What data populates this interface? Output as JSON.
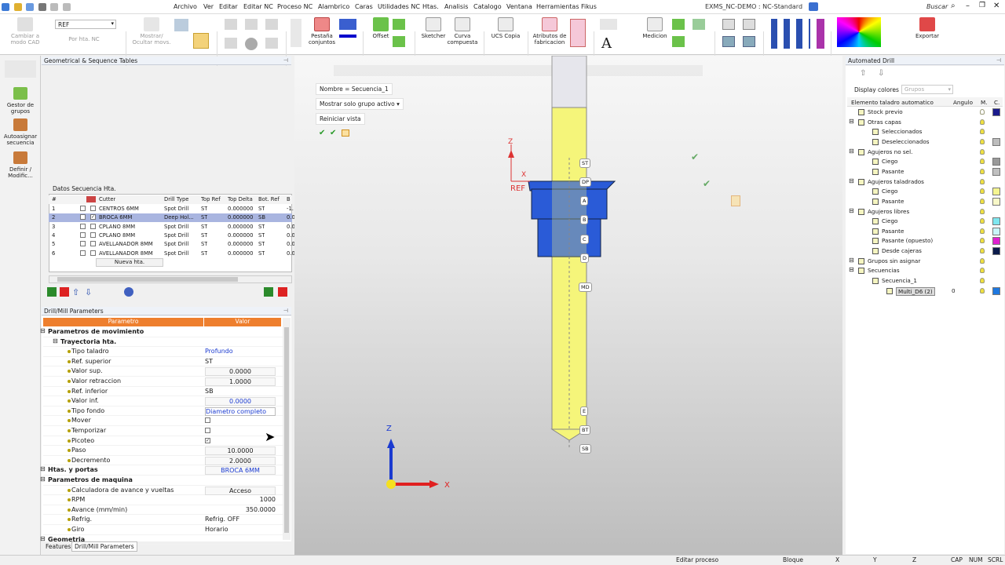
{
  "menubar": {
    "items": [
      "Archivo",
      "Ver",
      "Editar",
      "Editar NC",
      "Proceso NC",
      "Alambrico",
      "Caras",
      "Utilidades NC",
      "Htas.",
      "Analisis",
      "Catalogo",
      "Ventana",
      "Herramientas Fikus"
    ],
    "title": "EXMS_NC-DEMO : NC-Standard",
    "search_label": "Buscar"
  },
  "ribbon": {
    "cambiar_modo": "Cambiar a modo CAD",
    "ref_value": "REF",
    "por_hta": "Por hta. NC",
    "mostrar_ocultar": "Mostrar/ Ocultar movs.",
    "pestana": "Pestaña conjuntos",
    "offset": "Offset",
    "sketcher": "Sketcher",
    "curva": "Curva compuesta",
    "ucs": "UCS Copia",
    "atributos": "Atributos de fabricacion",
    "medicion": "Medicion",
    "exportar": "Exportar"
  },
  "leftbar": {
    "gestor": "Gestor de grupos",
    "autoasignar": "Autoasignar secuencia",
    "definir": "Definir / Modific..."
  },
  "seq_panel": {
    "title": "Geometrical & Sequence Tables",
    "subtitle": "Datos Secuencia Hta.",
    "headers": [
      "#",
      "Cutter",
      "Drill Type",
      "Top Ref",
      "Top Delta",
      "Bot. Ref",
      "B"
    ],
    "rows": [
      {
        "n": "1",
        "cutter": "CENTROS 6MM",
        "type": "Spot Drill",
        "top": "ST",
        "delta": "0.000000",
        "bot": "ST",
        "b": "-1.",
        "checked": false
      },
      {
        "n": "2",
        "cutter": "BROCA 6MM",
        "type": "Deep Hol...",
        "top": "ST",
        "delta": "0.000000",
        "bot": "SB",
        "b": "0.0",
        "checked": true
      },
      {
        "n": "3",
        "cutter": "CPLANO 8MM",
        "type": "Spot Drill",
        "top": "ST",
        "delta": "0.000000",
        "bot": "ST",
        "b": "0.0",
        "checked": false
      },
      {
        "n": "4",
        "cutter": "CPLANO 8MM",
        "type": "Spot Drill",
        "top": "ST",
        "delta": "0.000000",
        "bot": "ST",
        "b": "0.0",
        "checked": false
      },
      {
        "n": "5",
        "cutter": "AVELLANADOR 8MM",
        "type": "Spot Drill",
        "top": "ST",
        "delta": "0.000000",
        "bot": "ST",
        "b": "0.0",
        "checked": false
      },
      {
        "n": "6",
        "cutter": "AVELLANADOR 8MM",
        "type": "Spot Drill",
        "top": "ST",
        "delta": "0.000000",
        "bot": "ST",
        "b": "0.0",
        "checked": false
      }
    ],
    "new_tool": "Nueva hta."
  },
  "params": {
    "title": "Drill/Mill Parameters",
    "col_param": "Parametro",
    "col_value": "Valor",
    "rows": [
      {
        "name": "Parametros de movimiento",
        "value": "",
        "level": 0,
        "bold": true
      },
      {
        "name": "Trayectoria hta.",
        "value": "",
        "level": 1,
        "bold": true
      },
      {
        "name": "Tipo taladro",
        "value": "Profundo",
        "level": 2
      },
      {
        "name": "Ref. superior",
        "value": "ST",
        "level": 2
      },
      {
        "name": "Valor sup.",
        "value": "0.0000",
        "level": 2
      },
      {
        "name": "Valor retraccion",
        "value": "1.0000",
        "level": 2
      },
      {
        "name": "Ref. inferior",
        "value": "SB",
        "level": 2
      },
      {
        "name": "Valor inf.",
        "value": "0.0000",
        "level": 2
      },
      {
        "name": "Tipo fondo",
        "value": "Diametro completo",
        "level": 2
      },
      {
        "name": "Mover",
        "value": "",
        "level": 2
      },
      {
        "name": "Temporizar",
        "value": "",
        "level": 2
      },
      {
        "name": "Picoteo",
        "value": "",
        "level": 2
      },
      {
        "name": "Paso",
        "value": "10.0000",
        "level": 2
      },
      {
        "name": "Decremento",
        "value": "2.0000",
        "level": 2
      },
      {
        "name": "Htas. y portas",
        "value": "BROCA 6MM",
        "level": 0,
        "bold": true
      },
      {
        "name": "Parametros de maquina",
        "value": "",
        "level": 0,
        "bold": true
      },
      {
        "name": "Calculadora de avance y vueltas",
        "value": "Acceso",
        "level": 2
      },
      {
        "name": "RPM",
        "value": "1000",
        "level": 2
      },
      {
        "name": "Avance (mm/min)",
        "value": "350.0000",
        "level": 2
      },
      {
        "name": "Refrig.",
        "value": "Refrig. OFF",
        "level": 2
      },
      {
        "name": "Giro",
        "value": "Horario",
        "level": 2
      },
      {
        "name": "Geometria",
        "value": "",
        "level": 0,
        "bold": true
      }
    ],
    "tab_features": "Features",
    "tab_drill": "Drill/Mill Parameters"
  },
  "viewport": {
    "nombre": "Nombre = Secuencia_1",
    "mostrar": "Mostrar solo grupo activo",
    "reiniciar": "Reiniciar vista",
    "axis_z": "Z",
    "axis_x": "X",
    "ref_label": "REF",
    "tags": [
      "ST",
      "DP",
      "A",
      "B",
      "C",
      "D",
      "MD",
      "E",
      "BT",
      "SB"
    ]
  },
  "auto_drill": {
    "title": "Automated Drill",
    "display_colors": "Display colores",
    "grupos": "Grupos",
    "col_elem": "Elemento taladro automatico",
    "col_angulo": "Angulo",
    "col_m": "M.",
    "col_c": "C.",
    "tree": [
      {
        "label": "Stock previo",
        "indent": 0,
        "color": "#1a1a8c"
      },
      {
        "label": "Otras capas",
        "indent": 0,
        "color": ""
      },
      {
        "label": "Seleccionados",
        "indent": 1,
        "color": ""
      },
      {
        "label": "Deseleccionados",
        "indent": 1,
        "color": "#bdbdbd"
      },
      {
        "label": "Agujeros no sel.",
        "indent": 0,
        "color": ""
      },
      {
        "label": "Ciego",
        "indent": 1,
        "color": "#9a9a9a"
      },
      {
        "label": "Pasante",
        "indent": 1,
        "color": "#c0c0c0"
      },
      {
        "label": "Agujeros taladrados",
        "indent": 0,
        "color": ""
      },
      {
        "label": "Ciego",
        "indent": 1,
        "color": "#f5f590"
      },
      {
        "label": "Pasante",
        "indent": 1,
        "color": "#f8f8c8"
      },
      {
        "label": "Agujeros libres",
        "indent": 0,
        "color": ""
      },
      {
        "label": "Ciego",
        "indent": 1,
        "color": "#7fe7ef"
      },
      {
        "label": "Pasante",
        "indent": 1,
        "color": "#c8f5f8"
      },
      {
        "label": "Pasante (opuesto)",
        "indent": 1,
        "color": "#e020d0"
      },
      {
        "label": "Desde cajeras",
        "indent": 1,
        "color": "#0a1a4a"
      },
      {
        "label": "Grupos sin asignar",
        "indent": 0,
        "color": ""
      },
      {
        "label": "Secuencias",
        "indent": 0,
        "color": ""
      },
      {
        "label": "Secuencia_1",
        "indent": 1,
        "color": ""
      },
      {
        "label": "Multi_D6 (2)",
        "indent": 2,
        "color": "#1e78e0",
        "angle": "0"
      }
    ]
  },
  "status": {
    "editar": "Editar proceso",
    "bloque": "Bloque",
    "x": "X",
    "y": "Y",
    "z": "Z",
    "cap": "CAP",
    "num": "NUM",
    "scrl": "SCRL"
  }
}
